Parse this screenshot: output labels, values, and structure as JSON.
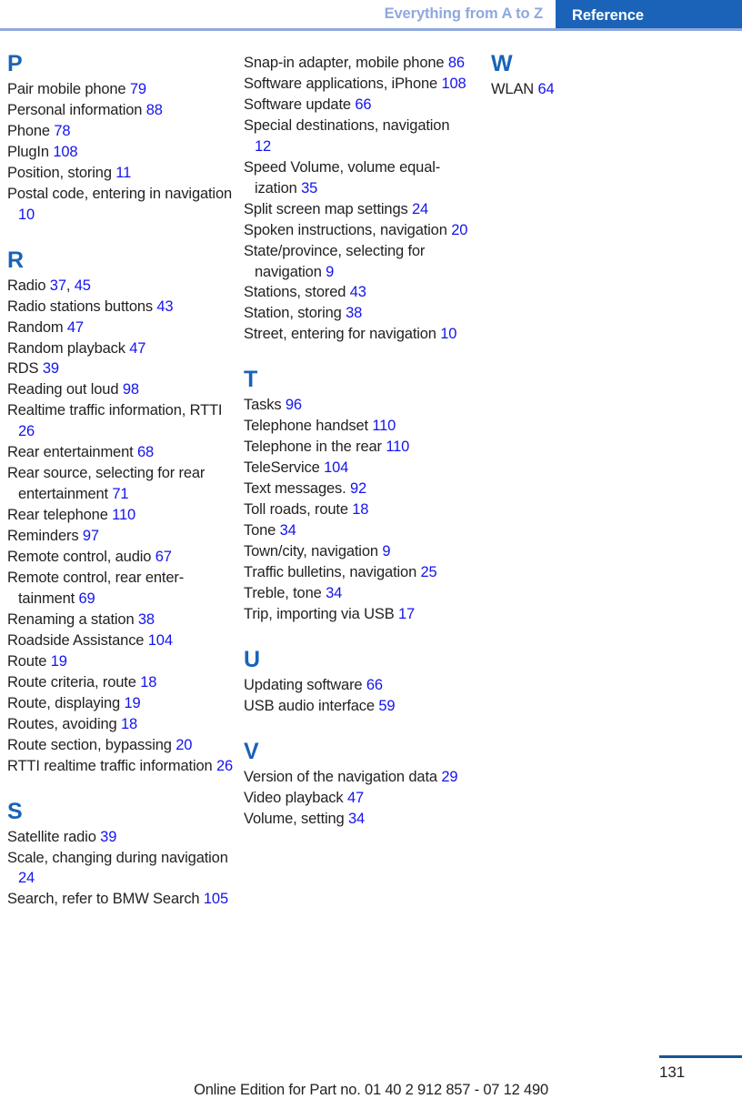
{
  "header": {
    "chapter_label": "Everything from A to Z",
    "section_label": "Reference",
    "rule_color": "#8fa9dd",
    "tab_bg": "#1a63b8",
    "tab_text_color": "#ffffff"
  },
  "colors": {
    "heading_blue": "#1a63b8",
    "page_link_blue": "#1414ee",
    "body_text": "#231f20",
    "footer_rule": "#1a5496"
  },
  "columns": [
    {
      "id": "column-1",
      "sections": [
        {
          "letter": "P",
          "entries": [
            {
              "text": "Pair mobile phone ",
              "pages": [
                "79"
              ]
            },
            {
              "text": "Personal information ",
              "pages": [
                "88"
              ]
            },
            {
              "text": "Phone ",
              "pages": [
                "78"
              ]
            },
            {
              "text": "PlugIn ",
              "pages": [
                "108"
              ]
            },
            {
              "text": "Position, storing ",
              "pages": [
                "11"
              ]
            },
            {
              "text": "Postal code, entering in navi­gation ",
              "pages": [
                "10"
              ]
            }
          ]
        },
        {
          "letter": "R",
          "entries": [
            {
              "text": "Radio ",
              "pages": [
                "37",
                "45"
              ]
            },
            {
              "text": "Radio stations buttons ",
              "pages": [
                "43"
              ]
            },
            {
              "text": "Random ",
              "pages": [
                "47"
              ]
            },
            {
              "text": "Random playback ",
              "pages": [
                "47"
              ]
            },
            {
              "text": "RDS ",
              "pages": [
                "39"
              ]
            },
            {
              "text": "Reading out loud ",
              "pages": [
                "98"
              ]
            },
            {
              "text": "Realtime traffic information, RTTI ",
              "pages": [
                "26"
              ]
            },
            {
              "text": "Rear entertainment ",
              "pages": [
                "68"
              ]
            },
            {
              "text": "Rear source, selecting for rear entertainment ",
              "pages": [
                "71"
              ]
            },
            {
              "text": "Rear telephone ",
              "pages": [
                "110"
              ]
            },
            {
              "text": "Reminders ",
              "pages": [
                "97"
              ]
            },
            {
              "text": "Remote control, audio ",
              "pages": [
                "67"
              ]
            },
            {
              "text": "Remote control, rear enter­tainment ",
              "pages": [
                "69"
              ]
            },
            {
              "text": "Renaming a station ",
              "pages": [
                "38"
              ]
            },
            {
              "text": "Roadside Assistance ",
              "pages": [
                "104"
              ]
            },
            {
              "text": "Route ",
              "pages": [
                "19"
              ]
            },
            {
              "text": "Route criteria, route ",
              "pages": [
                "18"
              ]
            },
            {
              "text": "Route, displaying ",
              "pages": [
                "19"
              ]
            },
            {
              "text": "Routes, avoiding ",
              "pages": [
                "18"
              ]
            },
            {
              "text": "Route section, bypassing ",
              "pages": [
                "20"
              ]
            },
            {
              "text": "RTTI realtime traffic informa­tion ",
              "pages": [
                "26"
              ]
            }
          ]
        },
        {
          "letter": "S",
          "entries": [
            {
              "text": "Satellite radio ",
              "pages": [
                "39"
              ]
            },
            {
              "text": "Scale, changing during navi­gation ",
              "pages": [
                "24"
              ]
            },
            {
              "text": "Search, refer to BMW Search ",
              "pages": [
                "105"
              ]
            }
          ]
        }
      ]
    },
    {
      "id": "column-2",
      "sections": [
        {
          "letter": "",
          "entries": [
            {
              "text": "Snap-in adapter, mobile phone ",
              "pages": [
                "86"
              ]
            },
            {
              "text": "Software applications, iPhone ",
              "pages": [
                "108"
              ]
            },
            {
              "text": "Software update ",
              "pages": [
                "66"
              ]
            },
            {
              "text": "Special destinations, naviga­tion ",
              "pages": [
                "12"
              ]
            },
            {
              "text": "Speed Volume, volume equal­ization ",
              "pages": [
                "35"
              ]
            },
            {
              "text": "Split screen map settings ",
              "pages": [
                "24"
              ]
            },
            {
              "text": "Spoken instructions, naviga­tion ",
              "pages": [
                "20"
              ]
            },
            {
              "text": "State/province, selecting for navigation ",
              "pages": [
                "9"
              ]
            },
            {
              "text": "Stations, stored ",
              "pages": [
                "43"
              ]
            },
            {
              "text": "Station, storing ",
              "pages": [
                "38"
              ]
            },
            {
              "text": "Street, entering for naviga­tion ",
              "pages": [
                "10"
              ]
            }
          ]
        },
        {
          "letter": "T",
          "entries": [
            {
              "text": "Tasks ",
              "pages": [
                "96"
              ]
            },
            {
              "text": "Telephone handset ",
              "pages": [
                "110"
              ]
            },
            {
              "text": "Telephone in the rear ",
              "pages": [
                "110"
              ]
            },
            {
              "text": "TeleService ",
              "pages": [
                "104"
              ]
            },
            {
              "text": "Text messages. ",
              "pages": [
                "92"
              ]
            },
            {
              "text": "Toll roads, route ",
              "pages": [
                "18"
              ]
            },
            {
              "text": "Tone ",
              "pages": [
                "34"
              ]
            },
            {
              "text": "Town/city, navigation ",
              "pages": [
                "9"
              ]
            },
            {
              "text": "Traffic bulletins, navigation ",
              "pages": [
                "25"
              ]
            },
            {
              "text": "Treble, tone ",
              "pages": [
                "34"
              ]
            },
            {
              "text": "Trip, importing via USB ",
              "pages": [
                "17"
              ]
            }
          ]
        },
        {
          "letter": "U",
          "entries": [
            {
              "text": "Updating software ",
              "pages": [
                "66"
              ]
            },
            {
              "text": "USB audio interface ",
              "pages": [
                "59"
              ]
            }
          ]
        },
        {
          "letter": "V",
          "entries": [
            {
              "text": "Version of the navigation data ",
              "pages": [
                "29"
              ]
            },
            {
              "text": "Video playback ",
              "pages": [
                "47"
              ]
            },
            {
              "text": "Volume, setting ",
              "pages": [
                "34"
              ]
            }
          ]
        }
      ]
    },
    {
      "id": "column-3",
      "sections": [
        {
          "letter": "W",
          "entries": [
            {
              "text": "WLAN ",
              "pages": [
                "64"
              ]
            }
          ]
        }
      ]
    }
  ],
  "footer": {
    "page_number": "131",
    "online_edition": "Online Edition for Part no. 01 40 2 912 857 - 07 12 490"
  }
}
